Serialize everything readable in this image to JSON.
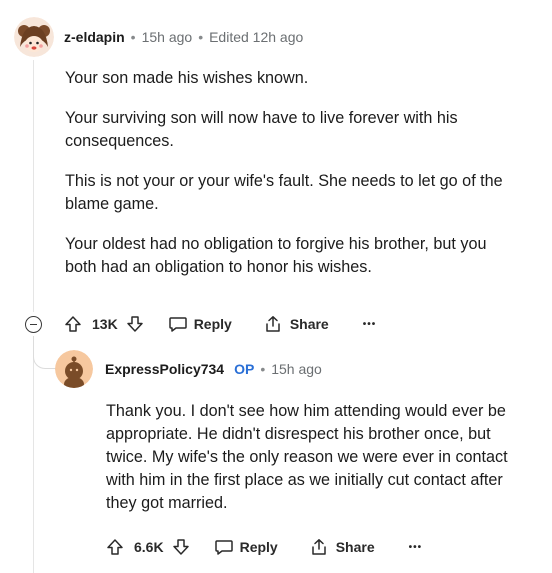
{
  "comment": {
    "username": "z-eldapin",
    "time": "15h ago",
    "edited": "Edited 12h ago",
    "paragraphs": [
      "Your son made his wishes known.",
      "Your surviving son will now have to live forever with his consequences.",
      "This is not your or your wife's fault. She needs to let go of the blame game.",
      "Your oldest had no obligation to forgive his brother, but you both had an obligation to honor his wishes."
    ],
    "votes": "13K",
    "reply_label": "Reply",
    "share_label": "Share",
    "more_label": "•••"
  },
  "reply": {
    "username": "ExpressPolicy734",
    "badge": "OP",
    "time": "15h ago",
    "paragraphs": [
      "Thank you. I don't see how him attending would ever be appropriate. He didn't disrespect his brother once, but twice. My wife's the only reason we were ever in contact with him in the first place as we initially cut contact after they got married."
    ],
    "votes": "6.6K",
    "reply_label": "Reply",
    "share_label": "Share",
    "more_label": "•••"
  },
  "colors": {
    "op_badge": "#2a6fd6",
    "muted": "#6b6f72",
    "thread": "#e5e5e5"
  }
}
